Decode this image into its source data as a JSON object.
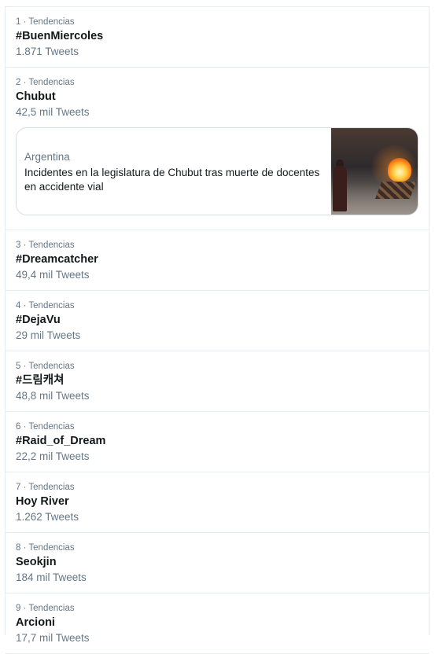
{
  "trends": [
    {
      "meta": "1 · Tendencias",
      "name": "#BuenMiercoles",
      "count": "1.871 Tweets"
    },
    {
      "meta": "2 · Tendencias",
      "name": "Chubut",
      "count": "42,5 mil Tweets",
      "card": {
        "category": "Argentina",
        "headline": "Incidentes en la legislatura de Chubut tras muerte de docentes en accidente vial"
      }
    },
    {
      "meta": "3 · Tendencias",
      "name": "#Dreamcatcher",
      "count": "49,4 mil Tweets"
    },
    {
      "meta": "4 · Tendencias",
      "name": "#DejaVu",
      "count": "29 mil Tweets"
    },
    {
      "meta": "5 · Tendencias",
      "name": "#드림캐쳐",
      "count": "48,8 mil Tweets"
    },
    {
      "meta": "6 · Tendencias",
      "name": "#Raid_of_Dream",
      "count": "22,2 mil Tweets"
    },
    {
      "meta": "7 · Tendencias",
      "name": "Hoy River",
      "count": "1.262 Tweets"
    },
    {
      "meta": "8 · Tendencias",
      "name": "Seokjin",
      "count": "184 mil Tweets"
    },
    {
      "meta": "9 · Tendencias",
      "name": "Arcioni",
      "count": "17,7 mil Tweets"
    }
  ]
}
